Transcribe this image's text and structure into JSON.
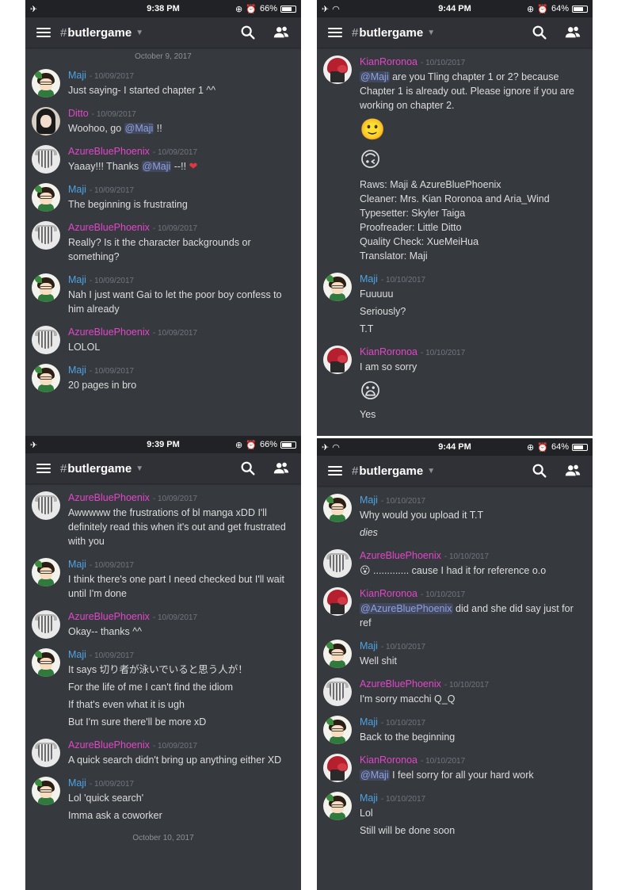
{
  "panels": [
    {
      "status": {
        "time": "9:38 PM",
        "battery": "66%",
        "wifi": false
      },
      "channel": "butlergame",
      "date_top": "October 9, 2017",
      "messages": [
        {
          "author": "Maji",
          "ts": "10/09/2017",
          "lines": [
            "Just saying- I started chapter 1 ^^"
          ]
        },
        {
          "author": "Ditto",
          "ts": "10/09/2017",
          "lines": [
            "Woohoo, go",
            "@Maji",
            "!!"
          ]
        },
        {
          "author": "AzureBluePhoenix",
          "ts": "10/09/2017",
          "lines": [
            "Yaaay!!! Thanks",
            "@Maji",
            "--!!"
          ]
        },
        {
          "author": "Maji",
          "ts": "10/09/2017",
          "lines": [
            "The beginning is frustrating"
          ]
        },
        {
          "author": "AzureBluePhoenix",
          "ts": "10/09/2017",
          "lines": [
            "Really? Is it the character backgrounds or something?"
          ]
        },
        {
          "author": "Maji",
          "ts": "10/09/2017",
          "lines": [
            "Nah I just want Gai to let the poor boy confess to him already"
          ]
        },
        {
          "author": "AzureBluePhoenix",
          "ts": "10/09/2017",
          "lines": [
            "LOLOL"
          ]
        },
        {
          "author": "Maji",
          "ts": "10/09/2017",
          "lines": [
            "20 pages in bro"
          ]
        }
      ]
    },
    {
      "status": {
        "time": "9:44 PM",
        "battery": "64%",
        "wifi": true
      },
      "channel": "butlergame",
      "messages": [
        {
          "author": "KianRoronoa",
          "ts": "10/10/2017",
          "lines": [
            "@Maji",
            "are you Tling chapter 1 or 2? because Chapter 1 is already out. Please ignore if you are working on chapter 2."
          ],
          "emojis": [
            "🙂",
            "🙃"
          ],
          "credits": [
            "Raws: Maji & AzureBluePhoenix",
            "Cleaner: Mrs. Kian Roronoa and Aria_Wind",
            "Typesetter: Skyler Taiga",
            "Proofreader: Little Ditto",
            "Quality Check: XueMeiHua",
            "Translator: Maji"
          ]
        },
        {
          "author": "Maji",
          "ts": "10/10/2017",
          "lines": [
            "Fuuuuu",
            "Seriously?",
            "T.T"
          ]
        },
        {
          "author": "KianRoronoa",
          "ts": "10/10/2017",
          "lines": [
            "I am so sorry",
            "Yes"
          ],
          "emoji": "😦"
        }
      ]
    },
    {
      "status": {
        "time": "9:39 PM",
        "battery": "66%",
        "wifi": false
      },
      "channel": "butlergame",
      "date_bottom": "October 10, 2017",
      "messages": [
        {
          "author": "AzureBluePhoenix",
          "ts": "10/09/2017",
          "lines": [
            "Awwwww the frustrations of bl manga xDD I'll definitely read this when it's out and get frustrated with you"
          ]
        },
        {
          "author": "Maji",
          "ts": "10/09/2017",
          "lines": [
            "I think there's one part I need checked but I'll wait until I'm done"
          ]
        },
        {
          "author": "AzureBluePhoenix",
          "ts": "10/09/2017",
          "lines": [
            "Okay-- thanks ^^"
          ]
        },
        {
          "author": "Maji",
          "ts": "10/09/2017",
          "lines": [
            "It says 切り者が泳いでいると思う人が！",
            "For the life of me I can't find the idiom",
            "If that's even what it is ugh",
            "But I'm sure there'll be more xD"
          ]
        },
        {
          "author": "AzureBluePhoenix",
          "ts": "10/09/2017",
          "lines": [
            "A quick search didn't bring up anything either XD"
          ]
        },
        {
          "author": "Maji",
          "ts": "10/09/2017",
          "lines": [
            "Lol 'quick search'",
            "Imma ask a coworker"
          ]
        }
      ]
    },
    {
      "status": {
        "time": "9:44 PM",
        "battery": "64%",
        "wifi": true
      },
      "channel": "butlergame",
      "messages": [
        {
          "author": "Maji",
          "ts": "10/10/2017",
          "lines": [
            "Why would you upload it T.T",
            "dies"
          ]
        },
        {
          "author": "AzureBluePhoenix",
          "ts": "10/10/2017",
          "lines": [
            "............. cause I had it for reference o.o"
          ],
          "emoji": "😮"
        },
        {
          "author": "KianRoronoa",
          "ts": "10/10/2017",
          "lines": [
            "@AzureBluePhoenix",
            "did and she did say just for ref"
          ]
        },
        {
          "author": "Maji",
          "ts": "10/10/2017",
          "lines": [
            "Well shit"
          ]
        },
        {
          "author": "AzureBluePhoenix",
          "ts": "10/10/2017",
          "lines": [
            "I'm sorry macchi Q_Q"
          ]
        },
        {
          "author": "Maji",
          "ts": "10/10/2017",
          "lines": [
            "Back to the beginning"
          ]
        },
        {
          "author": "KianRoronoa",
          "ts": "10/10/2017",
          "lines": [
            "@Maji",
            "I feel sorry for all your hard work"
          ]
        },
        {
          "author": "Maji",
          "ts": "10/10/2017",
          "lines": [
            "Lol",
            "Still will be done soon"
          ]
        }
      ]
    }
  ],
  "colors": {
    "background": "#36393e",
    "topbar": "#2f3136",
    "author_pink": "#e246c8",
    "author_blue": "#4fa3e3",
    "mention": "#8ea1e1"
  },
  "icons": [
    "airplane-icon",
    "wifi-icon",
    "alarm-icon",
    "battery-icon",
    "menu-icon",
    "search-icon",
    "members-icon",
    "dropdown-caret-icon",
    "heart-emoji"
  ]
}
